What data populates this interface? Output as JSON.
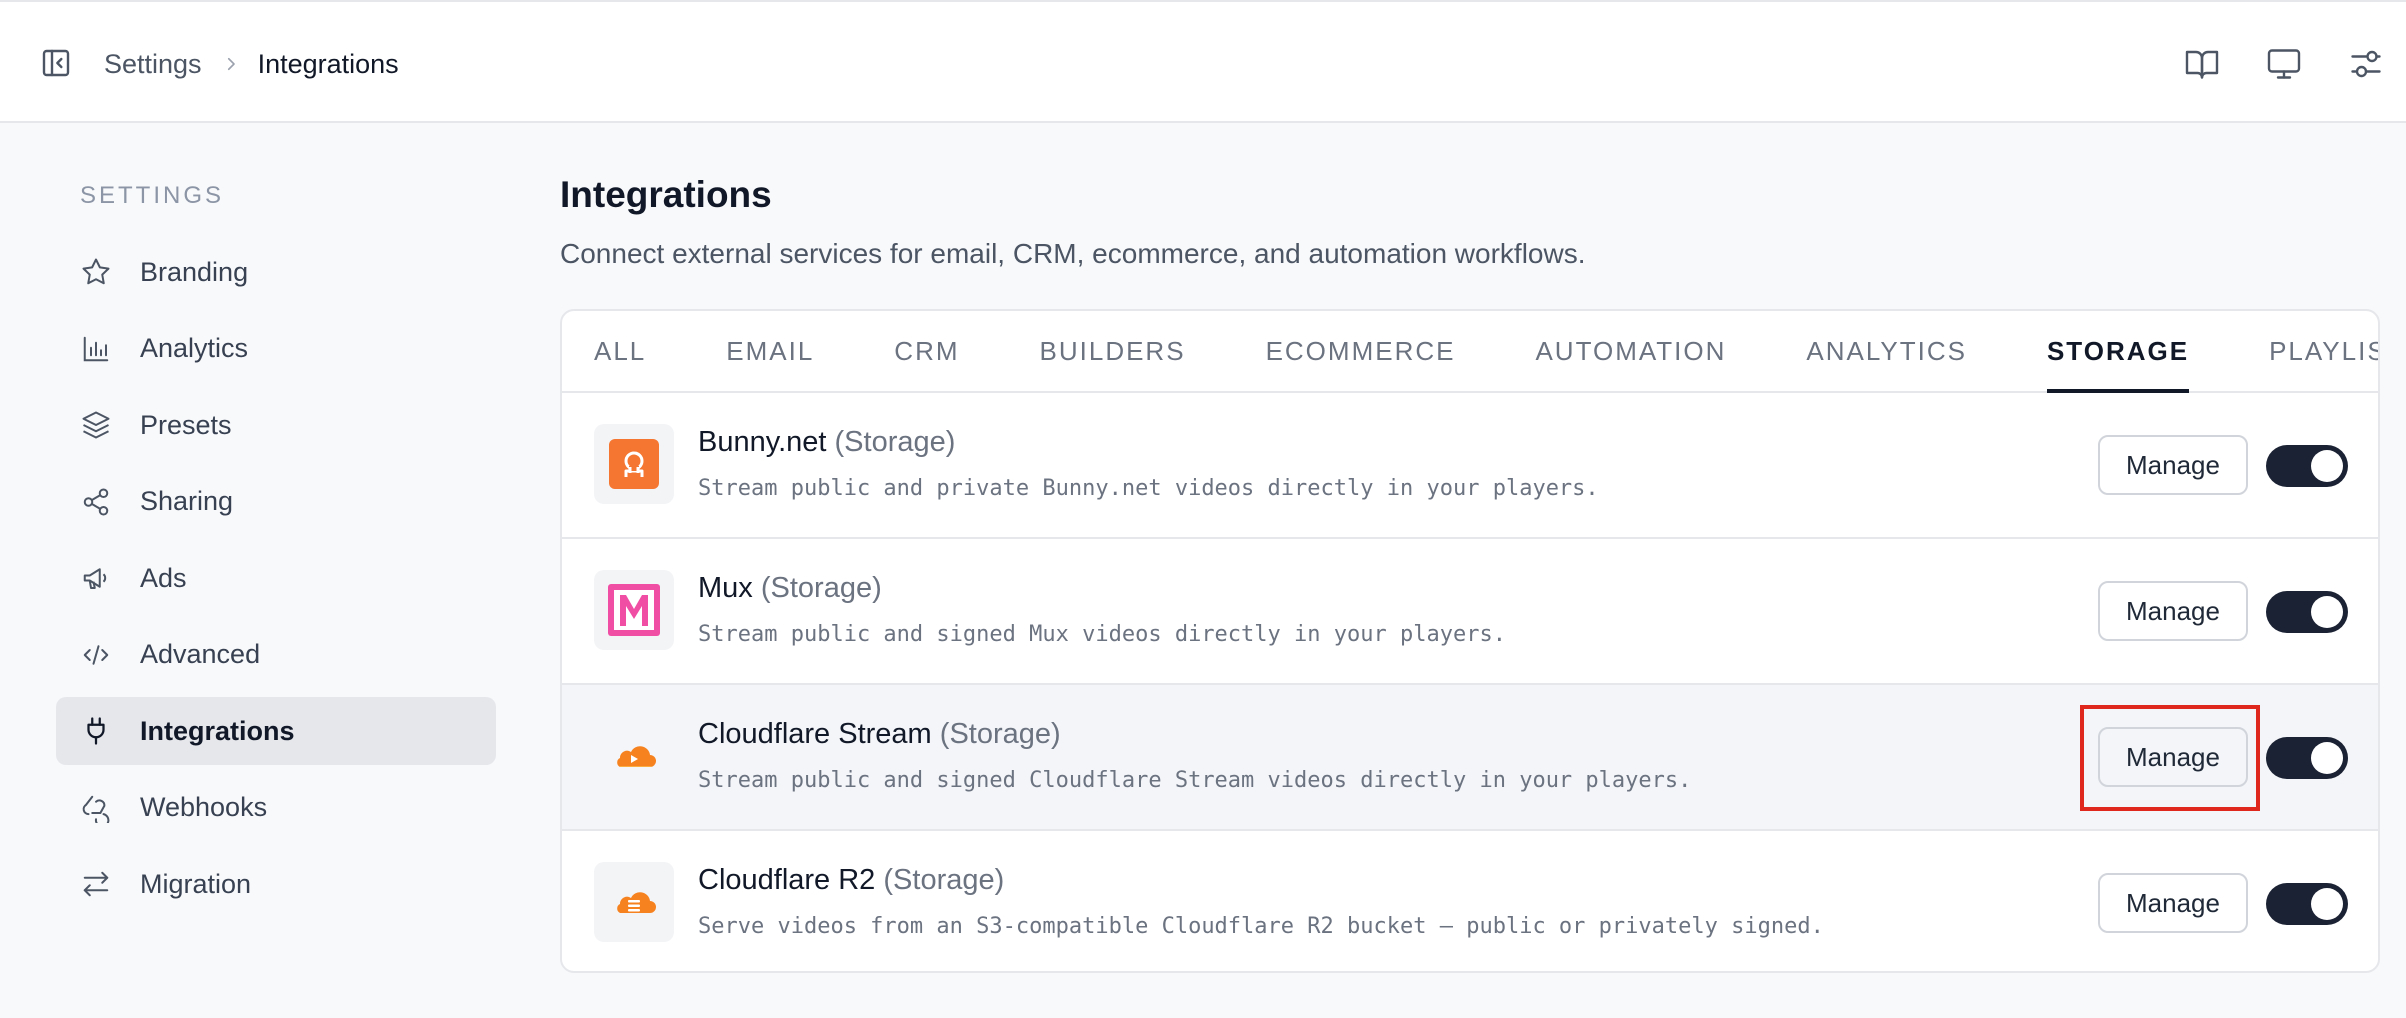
{
  "breadcrumb": {
    "parent": "Settings",
    "current": "Integrations"
  },
  "topbar_icons": [
    "book-open-icon",
    "monitor-icon",
    "sliders-icon"
  ],
  "sidebar": {
    "heading": "SETTINGS",
    "items": [
      {
        "label": "Branding",
        "icon": "star-icon"
      },
      {
        "label": "Analytics",
        "icon": "bar-chart-icon"
      },
      {
        "label": "Presets",
        "icon": "layers-icon"
      },
      {
        "label": "Sharing",
        "icon": "share-icon"
      },
      {
        "label": "Ads",
        "icon": "megaphone-icon"
      },
      {
        "label": "Advanced",
        "icon": "code-icon"
      },
      {
        "label": "Integrations",
        "icon": "plug-icon",
        "active": true
      },
      {
        "label": "Webhooks",
        "icon": "webhook-icon"
      },
      {
        "label": "Migration",
        "icon": "arrows-swap-icon"
      }
    ]
  },
  "main": {
    "title": "Integrations",
    "description": "Connect external services for email, CRM, ecommerce, and automation workflows.",
    "tabs": [
      {
        "label": "ALL"
      },
      {
        "label": "EMAIL"
      },
      {
        "label": "CRM"
      },
      {
        "label": "BUILDERS"
      },
      {
        "label": "ECOMMERCE"
      },
      {
        "label": "AUTOMATION"
      },
      {
        "label": "ANALYTICS"
      },
      {
        "label": "STORAGE",
        "active": true
      },
      {
        "label": "PLAYLIST"
      }
    ],
    "integrations": [
      {
        "name": "Bunny.net",
        "tag": "(Storage)",
        "description": "Stream public and private Bunny.net videos directly in your players.",
        "button": "Manage",
        "enabled": true,
        "logo": "bunny-logo"
      },
      {
        "name": "Mux",
        "tag": "(Storage)",
        "description": "Stream public and signed Mux videos directly in your players.",
        "button": "Manage",
        "enabled": true,
        "logo": "mux-logo"
      },
      {
        "name": "Cloudflare Stream",
        "tag": "(Storage)",
        "description": "Stream public and signed Cloudflare Stream videos directly in your players.",
        "button": "Manage",
        "enabled": true,
        "logo": "cloudflare-stream-logo",
        "highlighted": true
      },
      {
        "name": "Cloudflare R2",
        "tag": "(Storage)",
        "description": "Serve videos from an S3-compatible Cloudflare R2 bucket — public or privately signed.",
        "button": "Manage",
        "enabled": true,
        "logo": "cloudflare-r2-logo"
      }
    ]
  },
  "colors": {
    "accent_dark": "#1b2233",
    "highlight_ring": "#e0271e",
    "bunny_orange": "#f47631",
    "mux_pink": "#f04ea5",
    "cloudflare_orange": "#f6821f"
  }
}
